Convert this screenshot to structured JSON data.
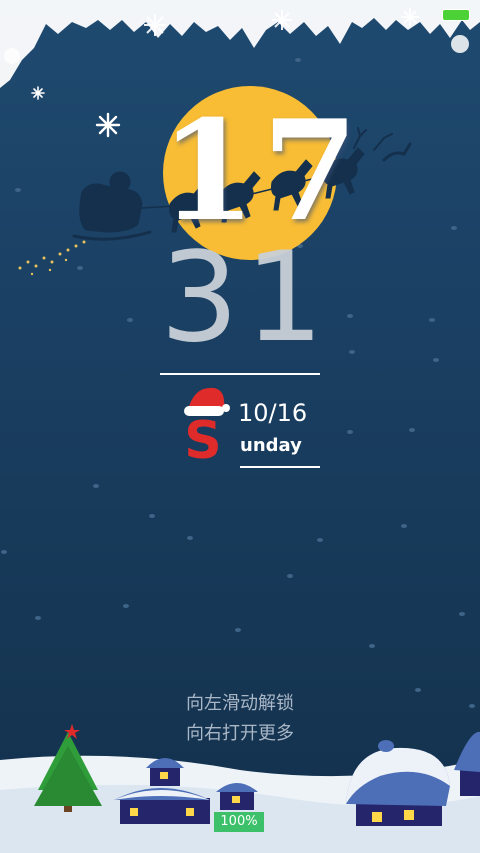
{
  "status_bar": {
    "battery_color": "#4cd137"
  },
  "clock": {
    "hour": "17",
    "minute": "31"
  },
  "date_block": {
    "date": "10/16",
    "weekday_initial": "S",
    "weekday_rest": "unday"
  },
  "unlock_hint": {
    "line1": "向左滑动解锁",
    "line2": "向右打开更多"
  },
  "charging": {
    "percent": "100%"
  },
  "colors": {
    "background": "#1a3f62",
    "moon": "#f8bd35",
    "santa_red": "#e02b2b",
    "charge_badge": "#3cc06a"
  },
  "icons": [
    "snowflake-icon",
    "sleigh-icon",
    "santa-hat-icon",
    "christmas-tree-icon",
    "snow-house-icon"
  ]
}
